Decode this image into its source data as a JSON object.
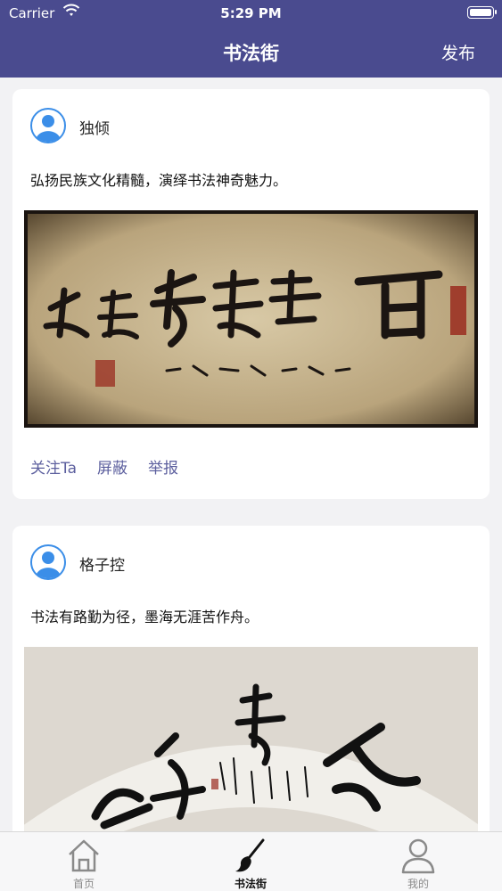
{
  "status_bar": {
    "carrier": "Carrier",
    "time": "5:29 PM"
  },
  "nav": {
    "title": "书法街",
    "publish_label": "发布"
  },
  "posts": [
    {
      "username": "独倾",
      "content": "弘扬民族文化精髓，演绎书法神奇魅力。",
      "actions": [
        "关注Ta",
        "屏蔽",
        "举报"
      ]
    },
    {
      "username": "格子控",
      "content": "书法有路勤为径，墨海无涯苦作舟。"
    }
  ],
  "tabs": [
    {
      "label": "首页",
      "icon": "home-icon"
    },
    {
      "label": "书法街",
      "icon": "brush-icon",
      "active": true
    },
    {
      "label": "我的",
      "icon": "person-icon"
    }
  ],
  "colors": {
    "nav_bg": "#4a4b8f",
    "action_text": "#5c5f9e",
    "avatar_blue": "#3b8ee8"
  }
}
